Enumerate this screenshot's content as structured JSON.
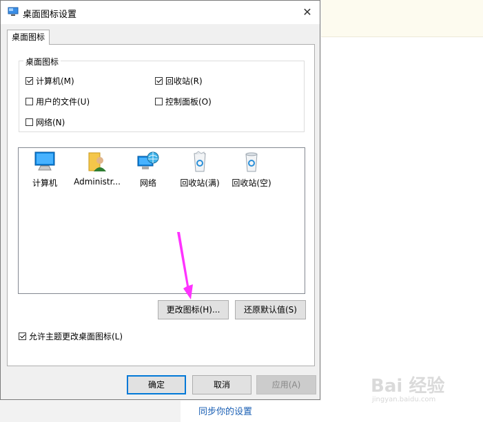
{
  "dialog": {
    "title": "桌面图标设置",
    "close_glyph": "✕",
    "tab": "桌面图标",
    "group_label": "桌面图标",
    "checkboxes": {
      "computer": {
        "label": "计算机(M)",
        "checked": true
      },
      "recycle_bin": {
        "label": "回收站(R)",
        "checked": true
      },
      "user_files": {
        "label": "用户的文件(U)",
        "checked": false
      },
      "control_panel": {
        "label": "控制面板(O)",
        "checked": false
      },
      "network": {
        "label": "网络(N)",
        "checked": false
      }
    },
    "icons": [
      {
        "label": "计算机",
        "icon": "computer-icon"
      },
      {
        "label": "Administr...",
        "icon": "user-folder-icon"
      },
      {
        "label": "网络",
        "icon": "network-icon"
      },
      {
        "label": "回收站(满)",
        "icon": "recycle-bin-full-icon"
      },
      {
        "label": "回收站(空)",
        "icon": "recycle-bin-empty-icon"
      }
    ],
    "change_icon_button": "更改图标(H)...",
    "restore_default_button": "还原默认值(S)",
    "allow_theme_checkbox": {
      "label": "允许主题更改桌面图标(L)",
      "checked": true
    },
    "ok_button": "确定",
    "cancel_button": "取消",
    "apply_button": "应用(A)"
  },
  "background": {
    "sync_link": "同步你的设置",
    "watermark": "Bai 经验",
    "watermark_sub": "jingyan.baidu.com"
  },
  "colors": {
    "accent": "#0078d7",
    "annotation_arrow": "#ff33ff",
    "link": "#1a5fb4"
  }
}
